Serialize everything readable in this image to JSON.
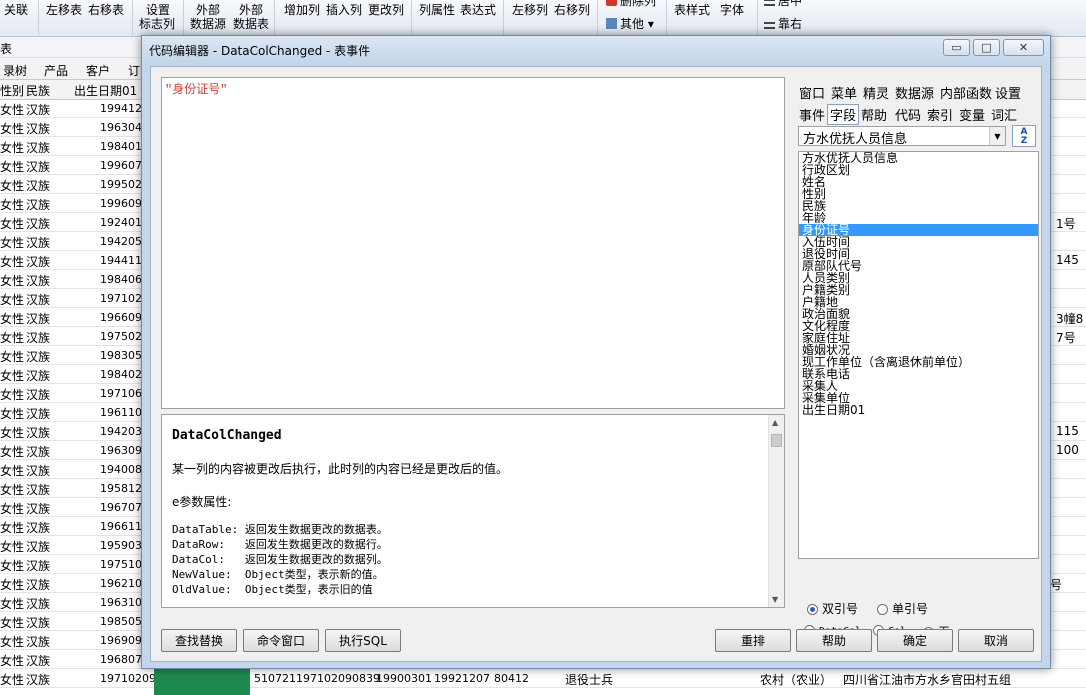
{
  "ribbon": {
    "items": [
      "关联",
      "左移表",
      "右移表",
      "设置",
      "标志列",
      "外部",
      "数据源",
      "外部",
      "数据表",
      "增加列",
      "插入列",
      "更改列",
      "列属性",
      "表达式",
      "左移列",
      "右移列",
      "删除列",
      "其他",
      "表样式",
      "字体",
      "居中",
      "靠右"
    ]
  },
  "strip2": {
    "items": [
      "表",
      "录树",
      "产品",
      "客户",
      "订"
    ]
  },
  "bg_table": {
    "headers": [
      "性别",
      "民族",
      "出生日期01"
    ],
    "rows": [
      {
        "sex": "女性",
        "nation": "汉族",
        "birth": "1994122"
      },
      {
        "sex": "女性",
        "nation": "汉族",
        "birth": "1963042"
      },
      {
        "sex": "女性",
        "nation": "汉族",
        "birth": "1984011"
      },
      {
        "sex": "女性",
        "nation": "汉族",
        "birth": "1996070"
      },
      {
        "sex": "女性",
        "nation": "汉族",
        "birth": "1995020"
      },
      {
        "sex": "女性",
        "nation": "汉族",
        "birth": "1996092"
      },
      {
        "sex": "女性",
        "nation": "汉族",
        "birth": "1924010"
      },
      {
        "sex": "女性",
        "nation": "汉族",
        "birth": "1942052"
      },
      {
        "sex": "女性",
        "nation": "汉族",
        "birth": "1944112"
      },
      {
        "sex": "女性",
        "nation": "汉族",
        "birth": "1984061"
      },
      {
        "sex": "女性",
        "nation": "汉族",
        "birth": "1971022"
      },
      {
        "sex": "女性",
        "nation": "汉族",
        "birth": "1966090"
      },
      {
        "sex": "女性",
        "nation": "汉族",
        "birth": "1975021"
      },
      {
        "sex": "女性",
        "nation": "汉族",
        "birth": "1983052"
      },
      {
        "sex": "女性",
        "nation": "汉族",
        "birth": "1984020"
      },
      {
        "sex": "女性",
        "nation": "汉族",
        "birth": "1971061"
      },
      {
        "sex": "女性",
        "nation": "汉族",
        "birth": "1961100"
      },
      {
        "sex": "女性",
        "nation": "汉族",
        "birth": "1942030"
      },
      {
        "sex": "女性",
        "nation": "汉族",
        "birth": "1963090"
      },
      {
        "sex": "女性",
        "nation": "汉族",
        "birth": "1940081"
      },
      {
        "sex": "女性",
        "nation": "汉族",
        "birth": "1958123"
      },
      {
        "sex": "女性",
        "nation": "汉族",
        "birth": "1967072"
      },
      {
        "sex": "女性",
        "nation": "汉族",
        "birth": "1966112"
      },
      {
        "sex": "女性",
        "nation": "汉族",
        "birth": "1959030"
      },
      {
        "sex": "女性",
        "nation": "汉族",
        "birth": "1975101"
      },
      {
        "sex": "女性",
        "nation": "汉族",
        "birth": "1962101"
      },
      {
        "sex": "女性",
        "nation": "汉族",
        "birth": "1963100"
      },
      {
        "sex": "女性",
        "nation": "汉族",
        "birth": "1985050"
      },
      {
        "sex": "女性",
        "nation": "汉族",
        "birth": "1969090"
      },
      {
        "sex": "女性",
        "nation": "汉族",
        "birth": "1968071"
      }
    ],
    "bottom_row": {
      "sex": "女性",
      "nation": "汉族",
      "birth": "19710209",
      "id": "510721197102090839",
      "d1": "19900301",
      "d2": "19921207",
      "code": "80412",
      "type": "退役士兵",
      "hukou": "农村（农业）",
      "addr": "四川省江油市方水乡官田村五组"
    },
    "right_side": [
      "1号",
      "145",
      "3幢8",
      "7号",
      "115",
      "100",
      "号"
    ]
  },
  "dialog": {
    "title": "代码编辑器 - DataColChanged - 表事件",
    "btn_minimize": "▭",
    "btn_maximize": "□",
    "btn_close": "✕"
  },
  "editor": {
    "content": "\"身份证号\""
  },
  "doc": {
    "heading": "DataColChanged",
    "description": "某一列的内容被更改后执行，此时列的内容已经是更改后的值。",
    "params_title": "e参数属性:",
    "params": [
      "DataTable: 返回发生数据更改的数据表。",
      "DataRow:   返回发生数据更改的数据行。",
      "DataCol:   返回发生数据更改的数据列。",
      "NewValue:  Object类型，表示新的值。",
      "OldValue:  Object类型，表示旧的值"
    ]
  },
  "tabs": {
    "row1": [
      "窗口",
      "菜单",
      "精灵",
      "数据源",
      "内部函数",
      "设置"
    ],
    "row2": [
      "事件",
      "字段",
      "帮助",
      "代码",
      "索引",
      "变量",
      "词汇"
    ],
    "active": "字段"
  },
  "table_select": {
    "value": "方水优抚人员信息"
  },
  "sort_button": {
    "top": "A",
    "bottom": "Z"
  },
  "fields": {
    "items": [
      "方水优抚人员信息",
      "行政区划",
      "姓名",
      "性别",
      "民族",
      "年龄",
      "身份证号",
      "入伍时间",
      "退役时间",
      "原部队代号",
      "人员类别",
      "户籍类别",
      "户籍地",
      "政治面貌",
      "文化程度",
      "家庭住址",
      "婚姻状况",
      "现工作单位（含离退休前单位）",
      "联系电话",
      "采集人",
      "采集单位",
      "出生日期01"
    ],
    "selected": "身份证号"
  },
  "quote_options": {
    "double": "双引号",
    "single": "单引号"
  },
  "insert_options": {
    "datacol": "DataCol",
    "col": "Col",
    "none": "无"
  },
  "buttons": {
    "find_replace": "查找替换",
    "command_window": "命令窗口",
    "exec_sql": "执行SQL",
    "rearrange": "重排",
    "help": "帮助",
    "ok": "确定",
    "cancel": "取消"
  },
  "colors": {
    "selection": "#3399ff",
    "editor_text": "#d04030",
    "frame": "#c3d6ea"
  }
}
